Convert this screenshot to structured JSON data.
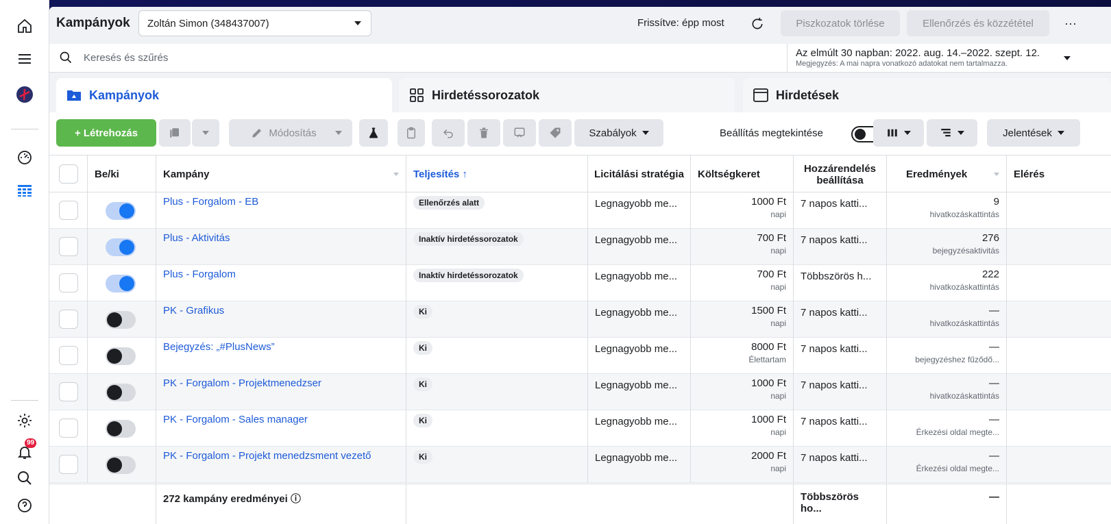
{
  "header": {
    "title": "Kampányok",
    "account": "Zoltán Simon (348437007)",
    "refresh_text": "Frissítve: épp most",
    "discard_label": "Piszkozatok törlése",
    "review_label": "Ellenőrzés és közzététel",
    "more_label": "···"
  },
  "search": {
    "placeholder": "Keresés és szűrés",
    "date_range": "Az elmúlt 30 napban: 2022. aug. 14.–2022. szept. 12.",
    "date_note": "Megjegyzés: A mai napra vonatkozó adatokat nem tartalmazza."
  },
  "tabs": [
    {
      "label": "Kampányok",
      "active": true
    },
    {
      "label": "Hirdetéssorozatok",
      "active": false
    },
    {
      "label": "Hirdetések",
      "active": false
    }
  ],
  "toolbar": {
    "create_label": "+ Létrehozás",
    "edit_label": "Módosítás",
    "rules_label": "Szabályok",
    "view_setup_label": "Beállítás megtekintése",
    "reports_label": "Jelentések"
  },
  "sidebar": {
    "notification_count": "99"
  },
  "table": {
    "columns": {
      "onoff": "Be/ki",
      "campaign": "Kampány",
      "delivery": "Teljesítés ↑",
      "bid": "Licitálási stratégia",
      "budget": "Költségkeret",
      "attribution": "Hozzárendelés beállítása",
      "results": "Eredmények",
      "reach": "Elérés"
    },
    "rows": [
      {
        "on": true,
        "name": "Plus - Forgalom - EB",
        "status": "Ellenőrzés alatt",
        "bid": "Legnagyobb me...",
        "budget": "1000 Ft",
        "budget_type": "napi",
        "attribution": "7 napos katti...",
        "result": "9",
        "result_type": "hivatkozáskattintás"
      },
      {
        "on": true,
        "name": "Plus - Aktivitás",
        "status": "Inaktív hirdetéssorozatok",
        "bid": "Legnagyobb me...",
        "budget": "700 Ft",
        "budget_type": "napi",
        "attribution": "7 napos katti...",
        "result": "276",
        "result_type": "bejegyzésaktivitás"
      },
      {
        "on": true,
        "name": "Plus - Forgalom",
        "status": "Inaktív hirdetéssorozatok",
        "bid": "Legnagyobb me...",
        "budget": "700 Ft",
        "budget_type": "napi",
        "attribution": "Többszörös h...",
        "result": "222",
        "result_type": "hivatkozáskattintás"
      },
      {
        "on": false,
        "name": "PK - Grafikus",
        "status": "Ki",
        "bid": "Legnagyobb me...",
        "budget": "1500 Ft",
        "budget_type": "napi",
        "attribution": "7 napos katti...",
        "result": "—",
        "result_type": "hivatkozáskattintás"
      },
      {
        "on": false,
        "name": "Bejegyzés: „#PlusNews”",
        "status": "Ki",
        "bid": "Legnagyobb me...",
        "budget": "8000 Ft",
        "budget_type": "Élettartam",
        "attribution": "7 napos katti...",
        "result": "—",
        "result_type": "bejegyzéshez fűződő..."
      },
      {
        "on": false,
        "name": "PK - Forgalom - Projektmenedzser",
        "status": "Ki",
        "bid": "Legnagyobb me...",
        "budget": "1000 Ft",
        "budget_type": "napi",
        "attribution": "7 napos katti...",
        "result": "—",
        "result_type": "hivatkozáskattintás"
      },
      {
        "on": false,
        "name": "PK - Forgalom - Sales manager",
        "status": "Ki",
        "bid": "Legnagyobb me...",
        "budget": "1000 Ft",
        "budget_type": "napi",
        "attribution": "7 napos katti...",
        "result": "—",
        "result_type": "Érkezési oldal megte..."
      },
      {
        "on": false,
        "name": "PK - Forgalom - Projekt menedzsment vezető",
        "status": "Ki",
        "bid": "Legnagyobb me...",
        "budget": "2000 Ft",
        "budget_type": "napi",
        "attribution": "7 napos katti...",
        "result": "—",
        "result_type": "Érkezési oldal megte..."
      }
    ],
    "footer": {
      "summary": "272 kampány eredményei ⓘ",
      "attribution": "Többszörös ho...",
      "result": "—"
    }
  },
  "colors": {
    "accent": "#1d5bd8",
    "create": "#5cb74c",
    "toggle_on": "#1877f2"
  }
}
